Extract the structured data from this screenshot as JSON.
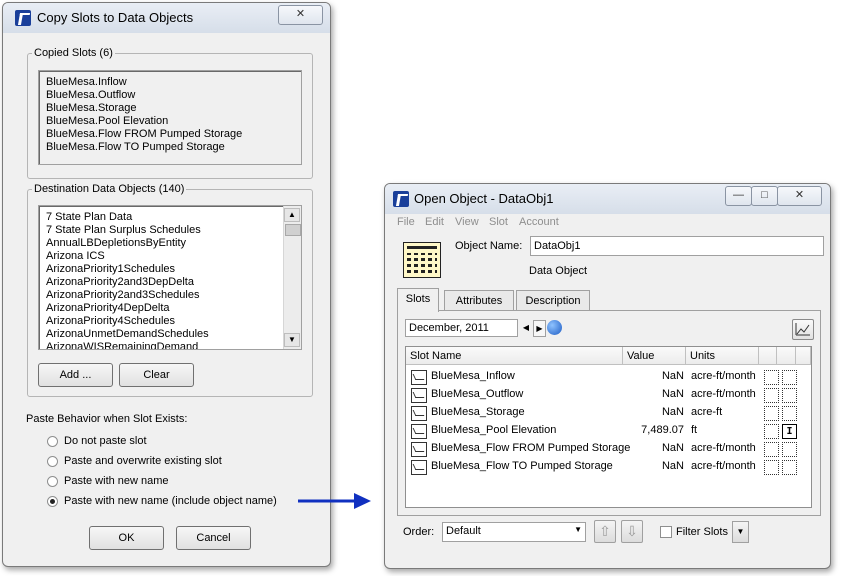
{
  "copy_dialog": {
    "title": "Copy Slots to Data Objects",
    "close_glyph": "✕",
    "copied_slots_legend": "Copied Slots (6)",
    "copied_slots": [
      "BlueMesa.Inflow",
      "BlueMesa.Outflow",
      "BlueMesa.Storage",
      "BlueMesa.Pool Elevation",
      "BlueMesa.Flow FROM Pumped Storage",
      "BlueMesa.Flow TO Pumped Storage"
    ],
    "destination_legend": "Destination Data Objects (140)",
    "destination_objects": [
      "7 State Plan Data",
      "7 State Plan Surplus Schedules",
      "AnnualLBDepletionsByEntity",
      "Arizona ICS",
      "ArizonaPriority1Schedules",
      "ArizonaPriority2and3DepDelta",
      "ArizonaPriority2and3Schedules",
      "ArizonaPriority4DepDelta",
      "ArizonaPriority4Schedules",
      "ArizonaUnmetDemandSchedules",
      "ArizonaWISRemainingDemand"
    ],
    "add_button": "Add ...",
    "clear_button": "Clear",
    "paste_behavior_label": "Paste Behavior when Slot Exists:",
    "paste_options": [
      {
        "label": "Do not paste slot",
        "selected": false
      },
      {
        "label": "Paste and overwrite existing slot",
        "selected": false
      },
      {
        "label": "Paste with new name",
        "selected": false
      },
      {
        "label": "Paste with new name (include object name)",
        "selected": true
      }
    ],
    "ok_button": "OK",
    "cancel_button": "Cancel"
  },
  "open_object": {
    "title": "Open Object - DataObj1",
    "window_buttons": {
      "minimize": "—",
      "maximize": "□",
      "close": "✕"
    },
    "menu": [
      "File",
      "Edit",
      "View",
      "Slot",
      "Account"
    ],
    "object_name_label": "Object Name:",
    "object_name_value": "DataObj1",
    "object_type": "Data Object",
    "tabs": [
      "Slots",
      "Attributes",
      "Description"
    ],
    "active_tab": "Slots",
    "date_value": "December, 2011",
    "table": {
      "headers": [
        "Slot Name",
        "Value",
        "Units"
      ],
      "rows": [
        {
          "name": "BlueMesa_Inflow",
          "value": "NaN",
          "units": "acre-ft/month"
        },
        {
          "name": "BlueMesa_Outflow",
          "value": "NaN",
          "units": "acre-ft/month"
        },
        {
          "name": "BlueMesa_Storage",
          "value": "NaN",
          "units": "acre-ft"
        },
        {
          "name": "BlueMesa_Pool Elevation",
          "value": "7,489.07",
          "units": "ft"
        },
        {
          "name": "BlueMesa_Flow FROM Pumped Storage",
          "value": "NaN",
          "units": "acre-ft/month"
        },
        {
          "name": "BlueMesa_Flow TO Pumped Storage",
          "value": "NaN",
          "units": "acre-ft/month"
        }
      ]
    },
    "order_label": "Order:",
    "order_value": "Default",
    "filter_label": "Filter Slots",
    "filter_checked": false
  },
  "colors": {
    "accent_arrow": "#1030c0",
    "titlebar": "#dbe3ee"
  }
}
